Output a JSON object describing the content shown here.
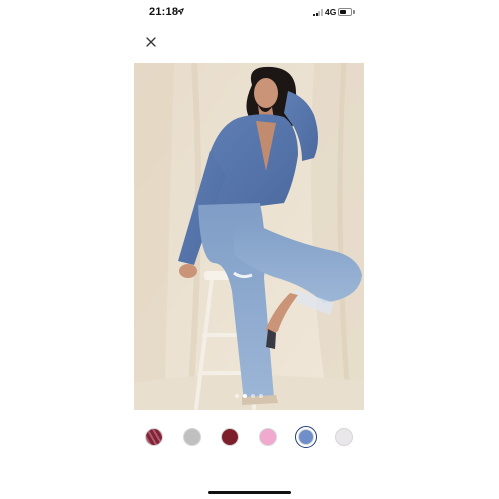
{
  "status_bar": {
    "time": "21:18",
    "location_icon": "location-arrow-icon",
    "network": "4G",
    "battery_level": 0.55
  },
  "close_button": {
    "icon": "close-icon"
  },
  "product_image": {
    "carousel_pages": 4,
    "active_page": 1
  },
  "color_swatches": [
    {
      "name": "swatch-burgundy-stripe",
      "color": "#7c2438"
    },
    {
      "name": "swatch-grey",
      "color": "#c0c0c0"
    },
    {
      "name": "swatch-maroon",
      "color": "#7d1f2b"
    },
    {
      "name": "swatch-pink",
      "color": "#f1a9cf"
    },
    {
      "name": "swatch-blue",
      "color": "#6f8fc9",
      "selected": true
    },
    {
      "name": "swatch-light-grey",
      "color": "#e9e7ea"
    }
  ]
}
